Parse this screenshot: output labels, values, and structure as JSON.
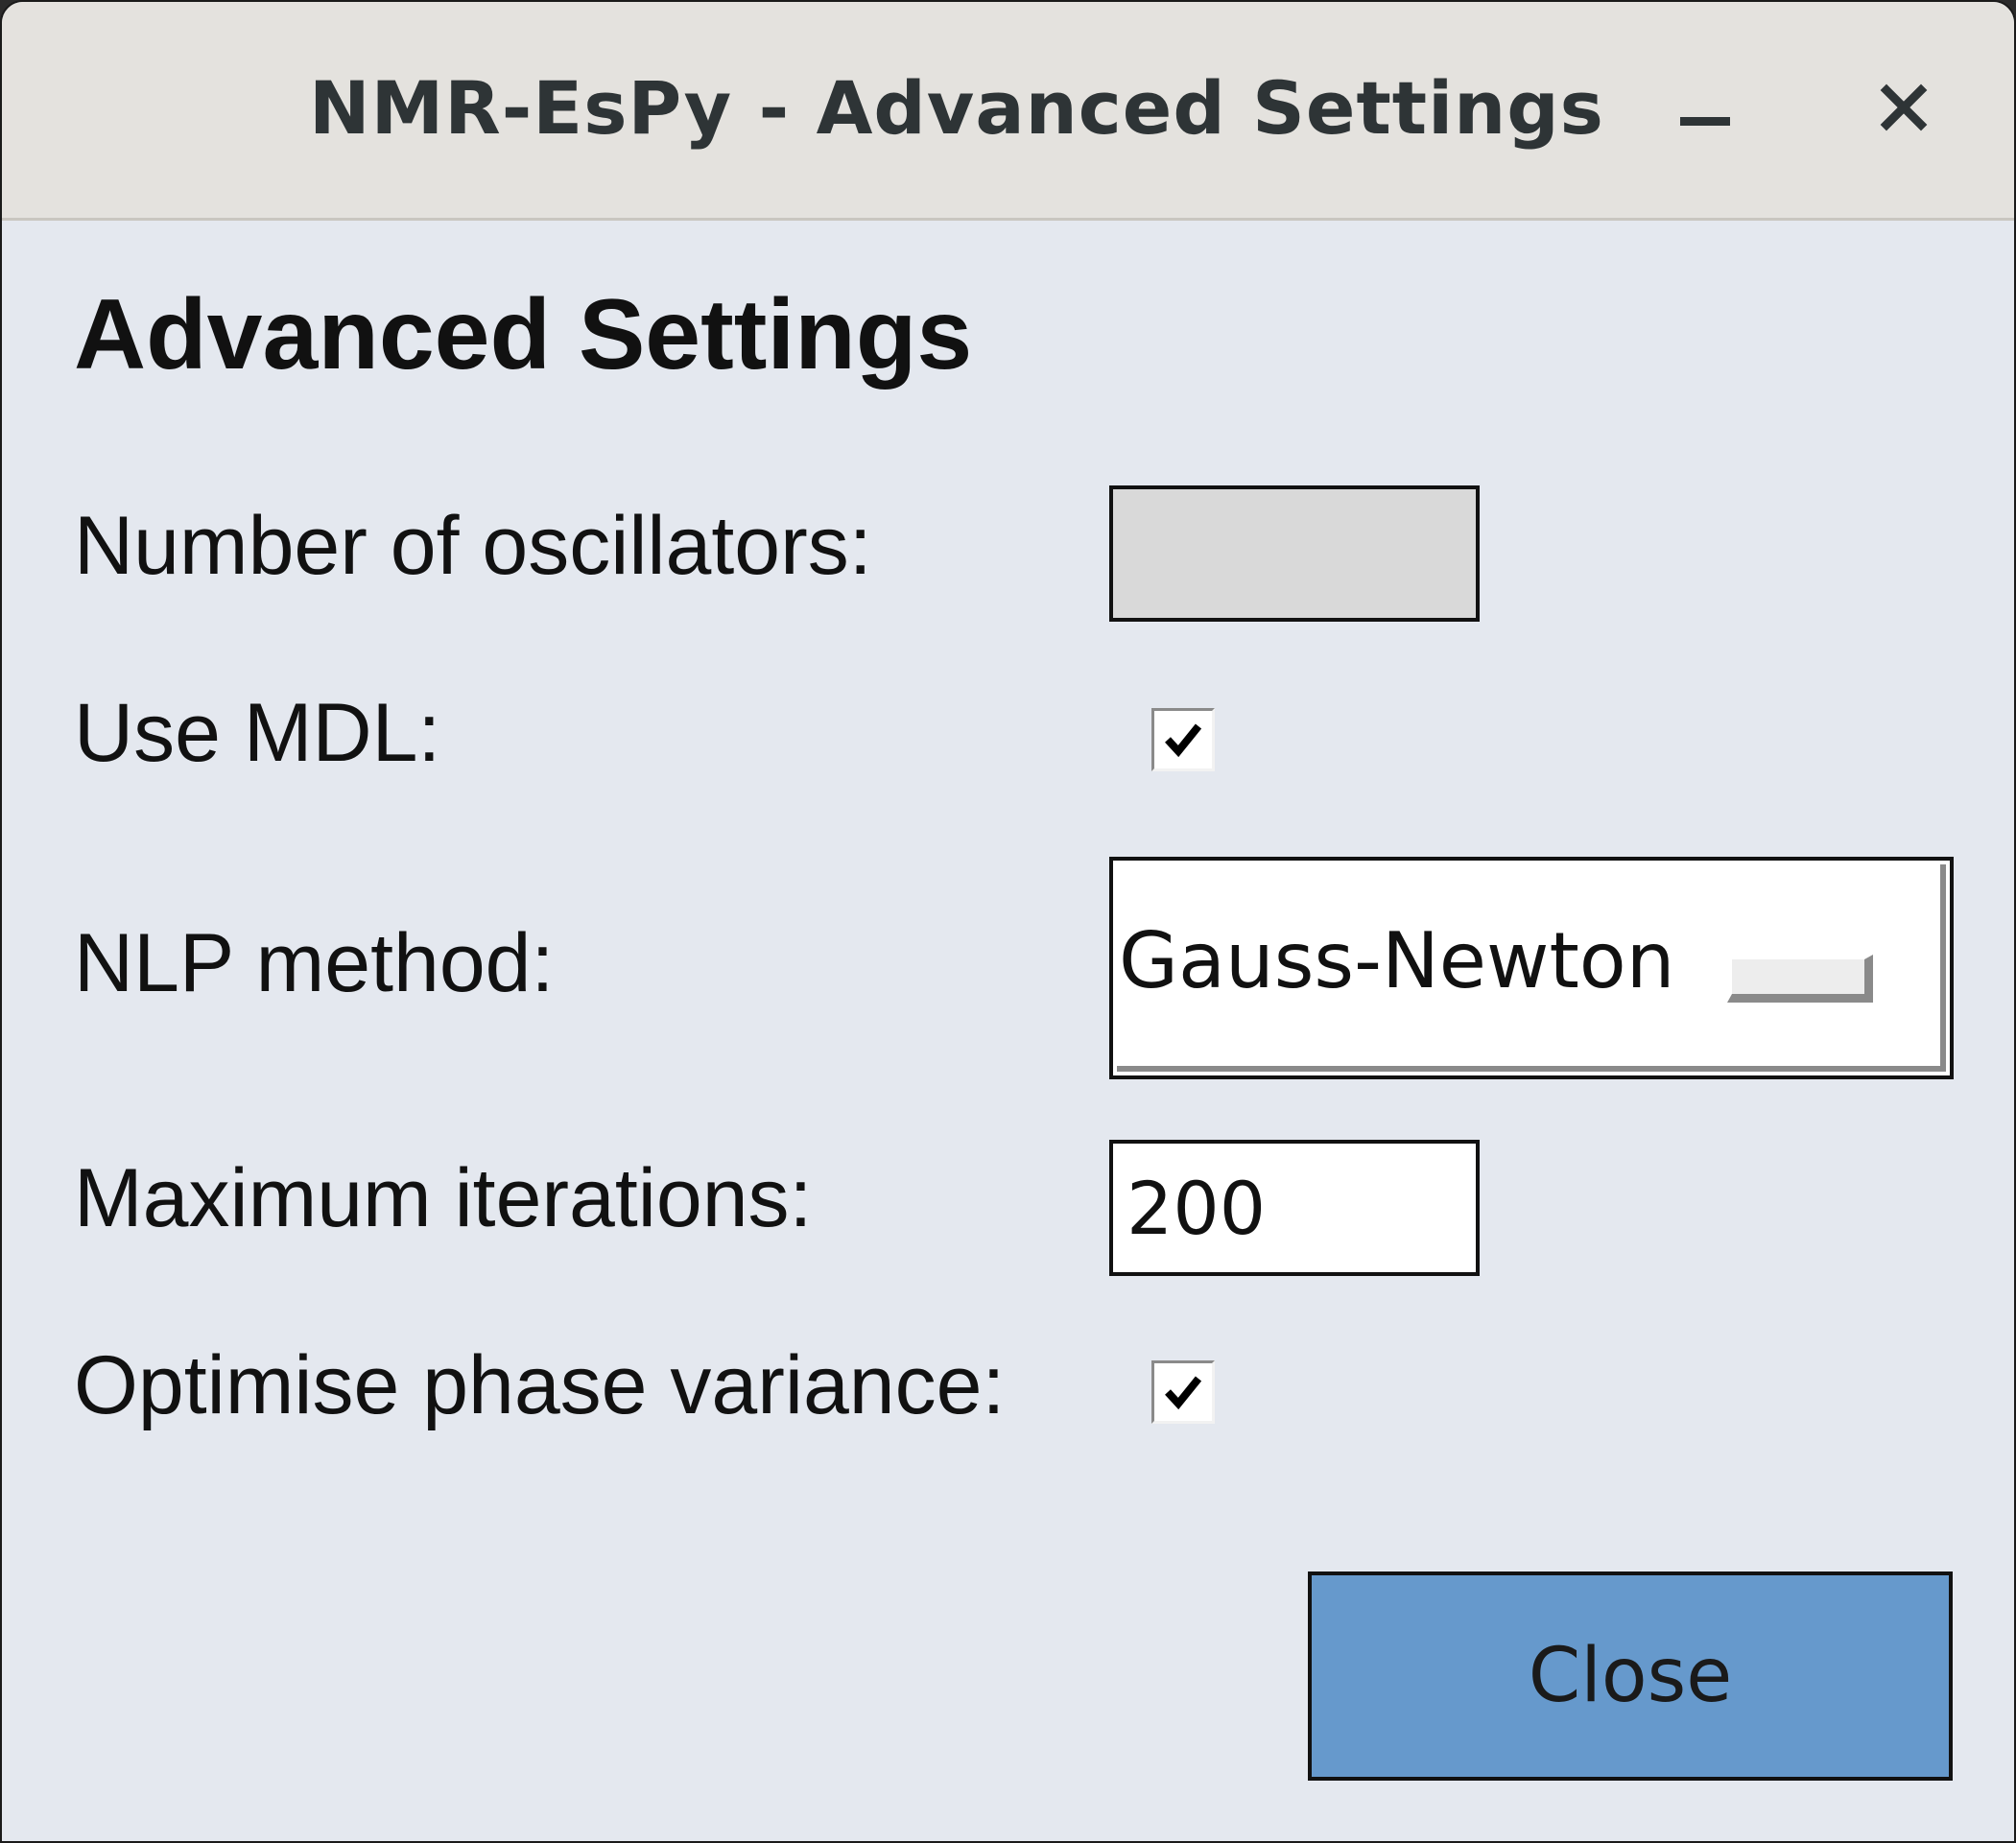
{
  "window": {
    "title": "NMR-EsPy - Advanced Settings",
    "minimize_icon": "minimize-icon",
    "close_icon": "close-icon"
  },
  "heading": "Advanced Settings",
  "fields": {
    "oscillators": {
      "label": "Number of oscillators:",
      "value": "",
      "state": "disabled"
    },
    "use_mdl": {
      "label": "Use MDL:",
      "checked": true
    },
    "nlp_method": {
      "label": "NLP method:",
      "value": "Gauss-Newton"
    },
    "max_iterations": {
      "label": "Maximum iterations:",
      "value": "200"
    },
    "optimise_phase_variance": {
      "label": "Optimise phase variance:",
      "checked": true
    }
  },
  "buttons": {
    "close_label": "Close"
  },
  "colors": {
    "background": "#e4e8ef",
    "titlebar": "#e4e2de",
    "button_accent": "#6699cc",
    "disabled_entry": "#d9d9d9"
  }
}
